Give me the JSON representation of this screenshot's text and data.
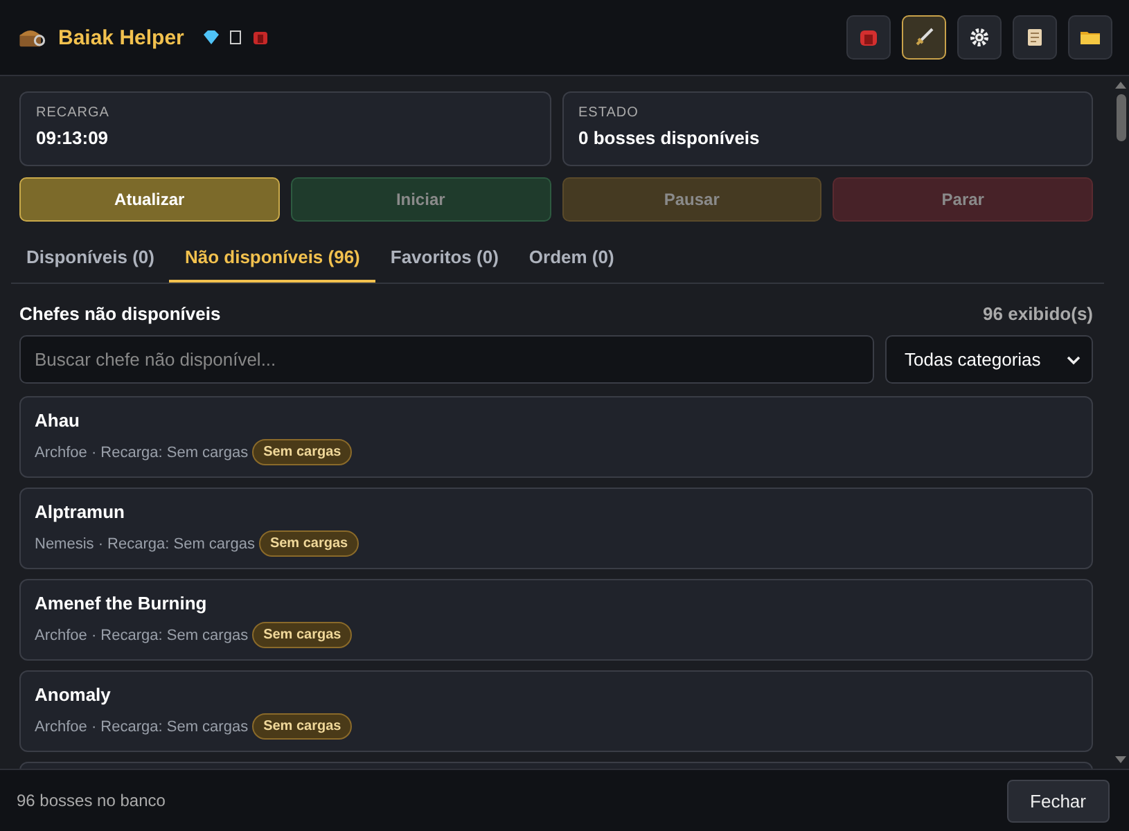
{
  "header": {
    "title": "Baiak Helper",
    "tools": [
      {
        "active": false
      },
      {
        "active": true
      },
      {
        "active": false
      },
      {
        "active": false
      },
      {
        "active": false
      }
    ]
  },
  "stats": [
    {
      "label": "RECARGA",
      "value": "09:13:09"
    },
    {
      "label": "ESTADO",
      "value": "0 bosses disponíveis"
    }
  ],
  "actions": [
    {
      "label": "Atualizar",
      "kind": "refresh",
      "disabled": false
    },
    {
      "label": "Iniciar",
      "kind": "start",
      "disabled": true
    },
    {
      "label": "Pausar",
      "kind": "pause",
      "disabled": true
    },
    {
      "label": "Parar",
      "kind": "stop",
      "disabled": true
    }
  ],
  "tabs": [
    {
      "label": "Disponíveis (0)",
      "selected": false
    },
    {
      "label": "Não disponíveis (96)",
      "selected": true
    },
    {
      "label": "Favoritos (0)",
      "selected": false
    },
    {
      "label": "Ordem (0)",
      "selected": false
    }
  ],
  "section": {
    "title": "Chefes não disponíveis",
    "count": "96 exibido(s)"
  },
  "search": {
    "placeholder": "Buscar chefe não disponível..."
  },
  "category": {
    "value": "Todas categorias"
  },
  "bosses": [
    {
      "name": "Ahau",
      "meta": "Archfoe · Recarga: Sem cargas",
      "badge": "Sem cargas"
    },
    {
      "name": "Alptramun",
      "meta": "Nemesis · Recarga: Sem cargas",
      "badge": "Sem cargas"
    },
    {
      "name": "Amenef the Burning",
      "meta": "Archfoe · Recarga: Sem cargas",
      "badge": "Sem cargas"
    },
    {
      "name": "Anomaly",
      "meta": "Archfoe · Recarga: Sem cargas",
      "badge": "Sem cargas"
    }
  ],
  "footer": {
    "text": "96 bosses no banco",
    "button": "Fechar"
  }
}
